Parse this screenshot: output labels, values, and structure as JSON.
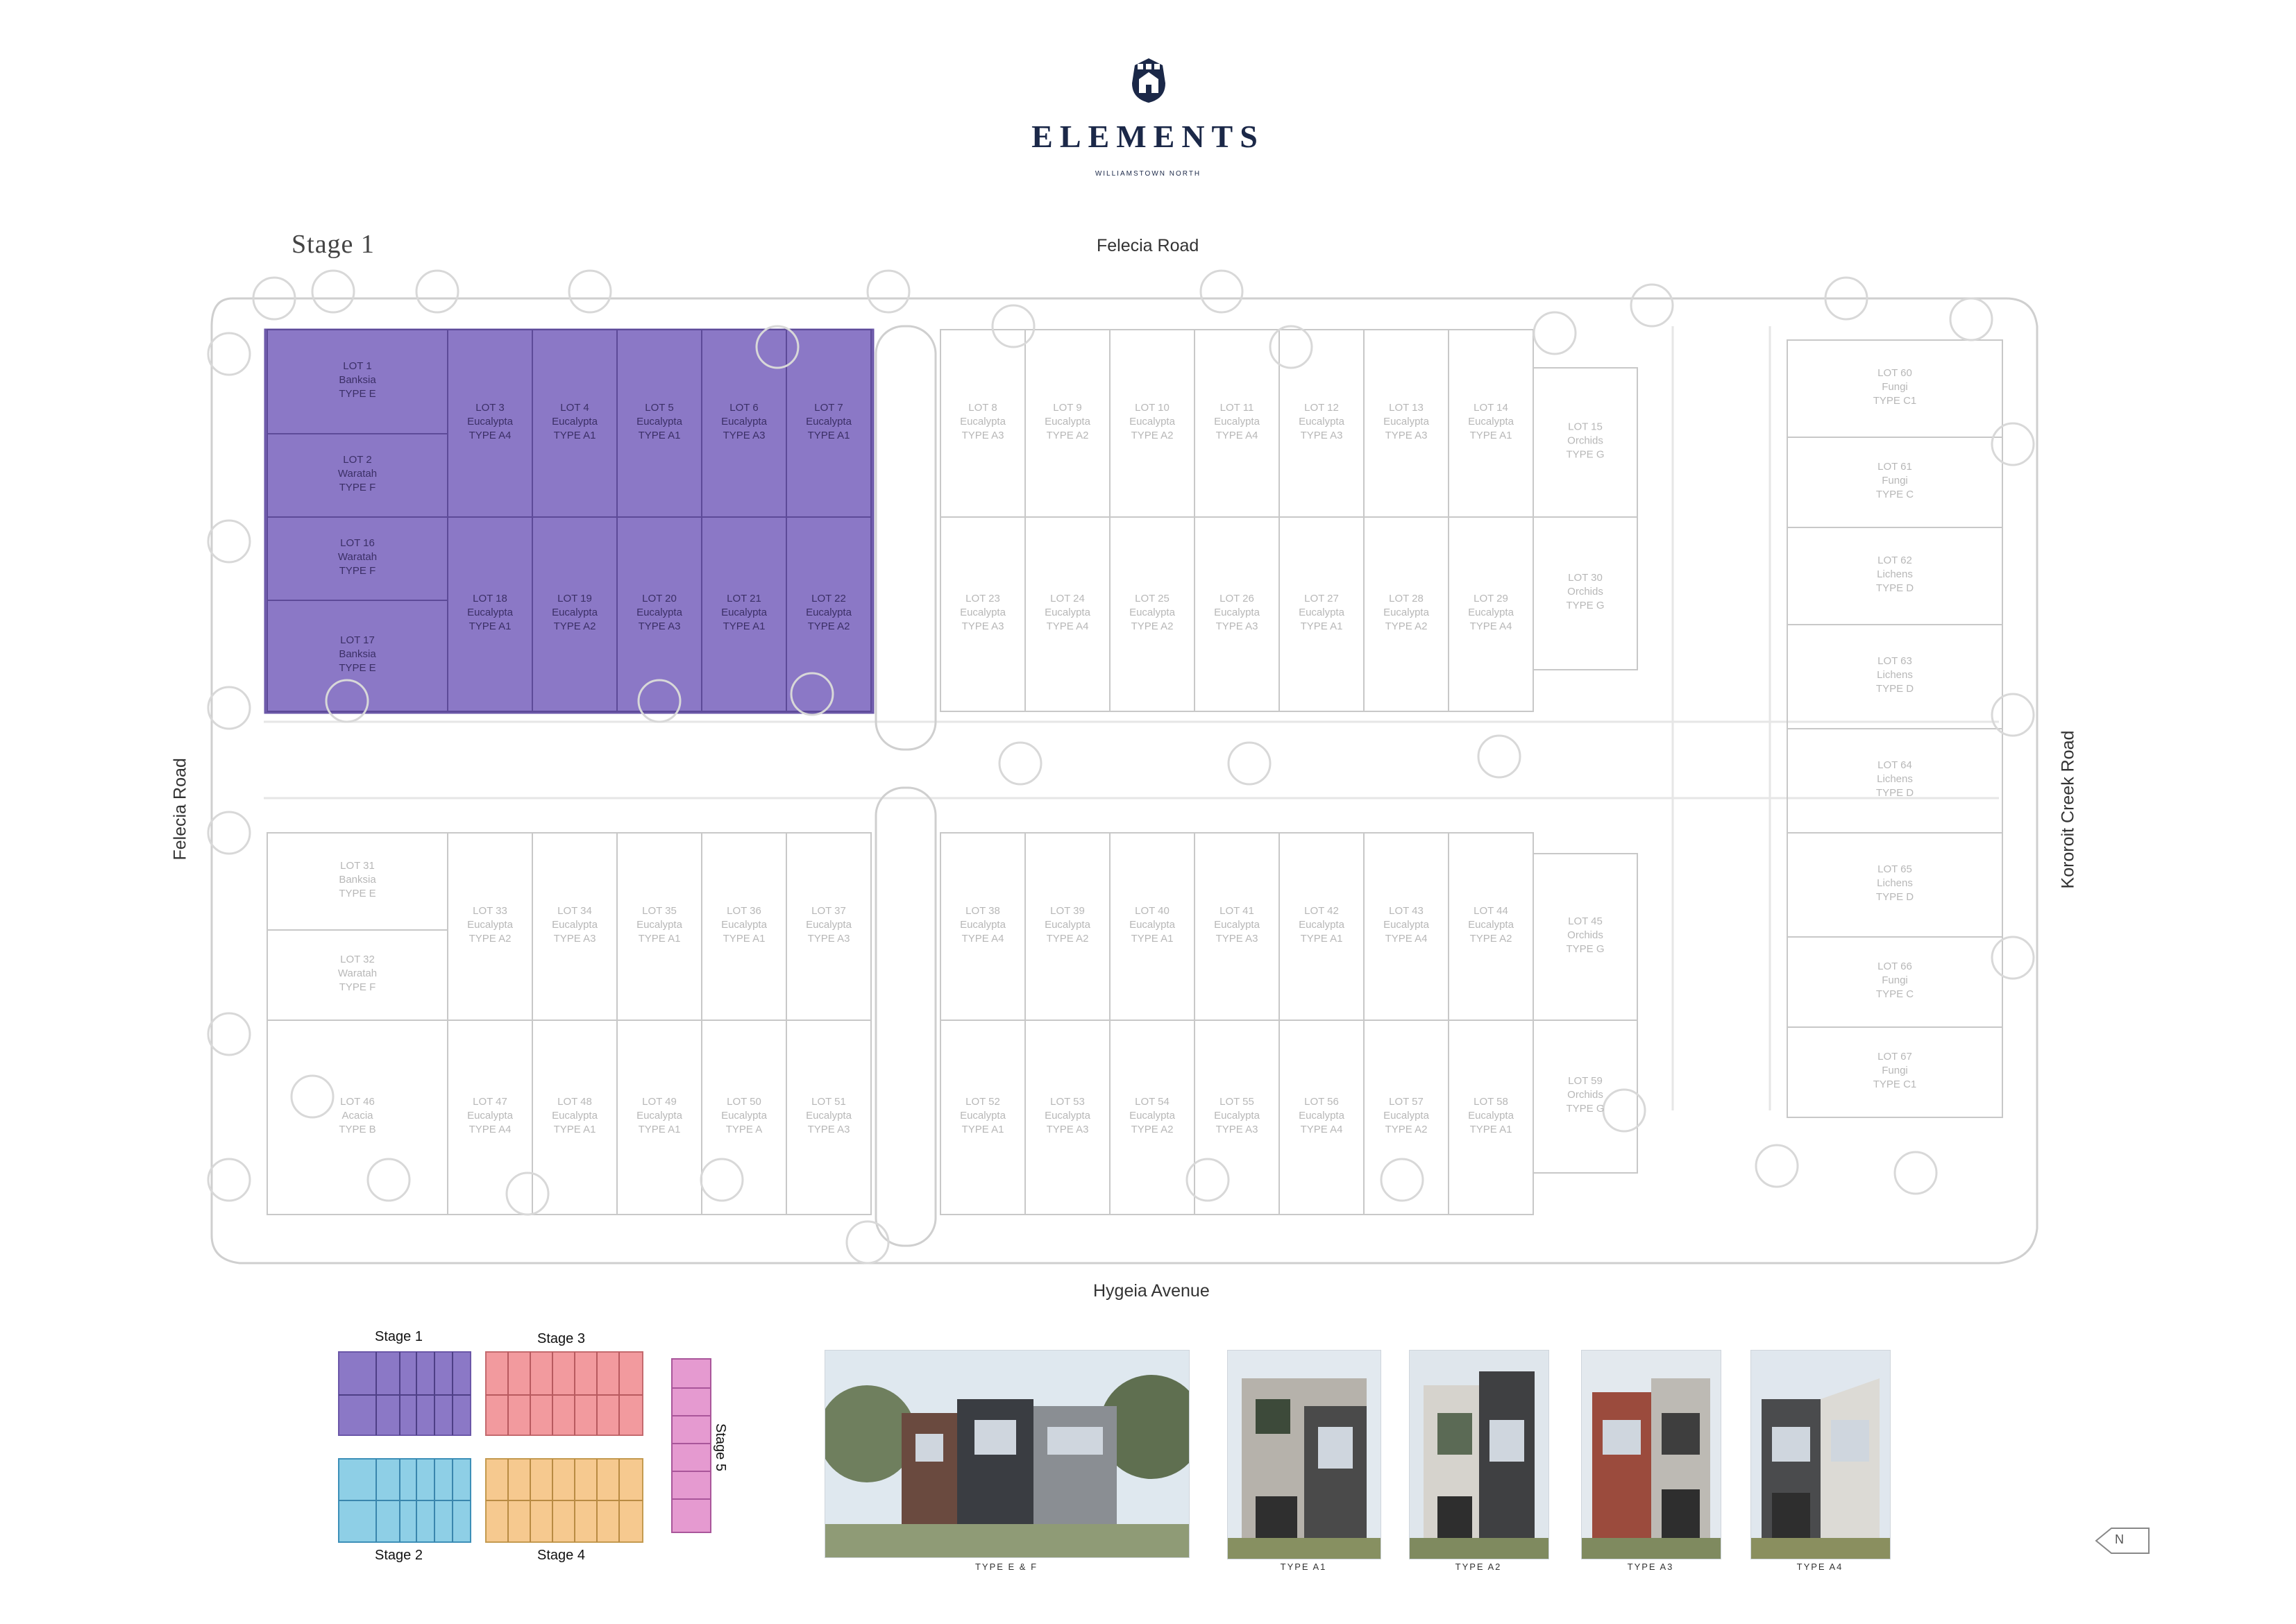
{
  "brand": {
    "name": "ELEMENTS",
    "subtitle": "WILLIAMSTOWN NORTH",
    "logo_icon": "house-crest-logo"
  },
  "stage_title": "Stage 1",
  "roads": {
    "north": "Felecia Road",
    "west": "Felecia Road",
    "south": "Hygeia Avenue",
    "east": "Kororoit Creek Road"
  },
  "colors": {
    "stage1": "#8b78c6",
    "stage1_border": "#6b57a8",
    "stage2": "#8ecfe6",
    "stage3": "#f29a9e",
    "stage4": "#f6c98f",
    "stage5": "#e59ad0",
    "linework": "#c8c8c8",
    "label_grey": "#b7b7b7",
    "brand_navy": "#1b2848"
  },
  "lots": [
    {
      "id": "LOT 1",
      "name": "Banksia",
      "type": "TYPE E",
      "stage": 1
    },
    {
      "id": "LOT 2",
      "name": "Waratah",
      "type": "TYPE F",
      "stage": 1
    },
    {
      "id": "LOT 3",
      "name": "Eucalypta",
      "type": "TYPE A4",
      "stage": 1
    },
    {
      "id": "LOT 4",
      "name": "Eucalypta",
      "type": "TYPE A1",
      "stage": 1
    },
    {
      "id": "LOT 5",
      "name": "Eucalypta",
      "type": "TYPE A1",
      "stage": 1
    },
    {
      "id": "LOT 6",
      "name": "Eucalypta",
      "type": "TYPE A3",
      "stage": 1
    },
    {
      "id": "LOT 7",
      "name": "Eucalypta",
      "type": "TYPE A1",
      "stage": 1
    },
    {
      "id": "LOT 16",
      "name": "Waratah",
      "type": "TYPE F",
      "stage": 1
    },
    {
      "id": "LOT 17",
      "name": "Banksia",
      "type": "TYPE E",
      "stage": 1
    },
    {
      "id": "LOT 18",
      "name": "Eucalypta",
      "type": "TYPE A1",
      "stage": 1
    },
    {
      "id": "LOT 19",
      "name": "Eucalypta",
      "type": "TYPE A2",
      "stage": 1
    },
    {
      "id": "LOT 20",
      "name": "Eucalypta",
      "type": "TYPE A3",
      "stage": 1
    },
    {
      "id": "LOT 21",
      "name": "Eucalypta",
      "type": "TYPE A1",
      "stage": 1
    },
    {
      "id": "LOT 22",
      "name": "Eucalypta",
      "type": "TYPE A2",
      "stage": 1
    },
    {
      "id": "LOT 8",
      "name": "Eucalypta",
      "type": "TYPE A3",
      "stage": 0
    },
    {
      "id": "LOT 9",
      "name": "Eucalypta",
      "type": "TYPE A2",
      "stage": 0
    },
    {
      "id": "LOT 10",
      "name": "Eucalypta",
      "type": "TYPE A2",
      "stage": 0
    },
    {
      "id": "LOT 11",
      "name": "Eucalypta",
      "type": "TYPE A4",
      "stage": 0
    },
    {
      "id": "LOT 12",
      "name": "Eucalypta",
      "type": "TYPE A3",
      "stage": 0
    },
    {
      "id": "LOT 13",
      "name": "Eucalypta",
      "type": "TYPE A3",
      "stage": 0
    },
    {
      "id": "LOT 14",
      "name": "Eucalypta",
      "type": "TYPE A1",
      "stage": 0
    },
    {
      "id": "LOT 15",
      "name": "Orchids",
      "type": "TYPE G",
      "stage": 0
    },
    {
      "id": "LOT 23",
      "name": "Eucalypta",
      "type": "TYPE A3",
      "stage": 0
    },
    {
      "id": "LOT 24",
      "name": "Eucalypta",
      "type": "TYPE A4",
      "stage": 0
    },
    {
      "id": "LOT 25",
      "name": "Eucalypta",
      "type": "TYPE A2",
      "stage": 0
    },
    {
      "id": "LOT 26",
      "name": "Eucalypta",
      "type": "TYPE A3",
      "stage": 0
    },
    {
      "id": "LOT 27",
      "name": "Eucalypta",
      "type": "TYPE A1",
      "stage": 0
    },
    {
      "id": "LOT 28",
      "name": "Eucalypta",
      "type": "TYPE A2",
      "stage": 0
    },
    {
      "id": "LOT 29",
      "name": "Eucalypta",
      "type": "TYPE A4",
      "stage": 0
    },
    {
      "id": "LOT 30",
      "name": "Orchids",
      "type": "TYPE G",
      "stage": 0
    },
    {
      "id": "LOT 31",
      "name": "Banksia",
      "type": "TYPE E",
      "stage": 0
    },
    {
      "id": "LOT 32",
      "name": "Waratah",
      "type": "TYPE F",
      "stage": 0
    },
    {
      "id": "LOT 33",
      "name": "Eucalypta",
      "type": "TYPE A2",
      "stage": 0
    },
    {
      "id": "LOT 34",
      "name": "Eucalypta",
      "type": "TYPE A3",
      "stage": 0
    },
    {
      "id": "LOT 35",
      "name": "Eucalypta",
      "type": "TYPE A1",
      "stage": 0
    },
    {
      "id": "LOT 36",
      "name": "Eucalypta",
      "type": "TYPE A1",
      "stage": 0
    },
    {
      "id": "LOT 37",
      "name": "Eucalypta",
      "type": "TYPE A3",
      "stage": 0
    },
    {
      "id": "LOT 38",
      "name": "Eucalypta",
      "type": "TYPE A4",
      "stage": 0
    },
    {
      "id": "LOT 39",
      "name": "Eucalypta",
      "type": "TYPE A2",
      "stage": 0
    },
    {
      "id": "LOT 40",
      "name": "Eucalypta",
      "type": "TYPE A1",
      "stage": 0
    },
    {
      "id": "LOT 41",
      "name": "Eucalypta",
      "type": "TYPE A3",
      "stage": 0
    },
    {
      "id": "LOT 42",
      "name": "Eucalypta",
      "type": "TYPE A1",
      "stage": 0
    },
    {
      "id": "LOT 43",
      "name": "Eucalypta",
      "type": "TYPE A4",
      "stage": 0
    },
    {
      "id": "LOT 44",
      "name": "Eucalypta",
      "type": "TYPE A2",
      "stage": 0
    },
    {
      "id": "LOT 45",
      "name": "Orchids",
      "type": "TYPE G",
      "stage": 0
    },
    {
      "id": "LOT 46",
      "name": "Acacia",
      "type": "TYPE B",
      "stage": 0
    },
    {
      "id": "LOT 47",
      "name": "Eucalypta",
      "type": "TYPE A4",
      "stage": 0
    },
    {
      "id": "LOT 48",
      "name": "Eucalypta",
      "type": "TYPE A1",
      "stage": 0
    },
    {
      "id": "LOT 49",
      "name": "Eucalypta",
      "type": "TYPE A1",
      "stage": 0
    },
    {
      "id": "LOT 50",
      "name": "Eucalypta",
      "type": "TYPE A",
      "stage": 0
    },
    {
      "id": "LOT 51",
      "name": "Eucalypta",
      "type": "TYPE A3",
      "stage": 0
    },
    {
      "id": "LOT 52",
      "name": "Eucalypta",
      "type": "TYPE A1",
      "stage": 0
    },
    {
      "id": "LOT 53",
      "name": "Eucalypta",
      "type": "TYPE A3",
      "stage": 0
    },
    {
      "id": "LOT 54",
      "name": "Eucalypta",
      "type": "TYPE A2",
      "stage": 0
    },
    {
      "id": "LOT 55",
      "name": "Eucalypta",
      "type": "TYPE A3",
      "stage": 0
    },
    {
      "id": "LOT 56",
      "name": "Eucalypta",
      "type": "TYPE A4",
      "stage": 0
    },
    {
      "id": "LOT 57",
      "name": "Eucalypta",
      "type": "TYPE A2",
      "stage": 0
    },
    {
      "id": "LOT 58",
      "name": "Eucalypta",
      "type": "TYPE A1",
      "stage": 0
    },
    {
      "id": "LOT 59",
      "name": "Orchids",
      "type": "TYPE G",
      "stage": 0
    },
    {
      "id": "LOT 60",
      "name": "Fungi",
      "type": "TYPE C1",
      "stage": 0
    },
    {
      "id": "LOT 61",
      "name": "Fungi",
      "type": "TYPE C",
      "stage": 0
    },
    {
      "id": "LOT 62",
      "name": "Lichens",
      "type": "TYPE D",
      "stage": 0
    },
    {
      "id": "LOT 63",
      "name": "Lichens",
      "type": "TYPE D",
      "stage": 0
    },
    {
      "id": "LOT 64",
      "name": "Lichens",
      "type": "TYPE D",
      "stage": 0
    },
    {
      "id": "LOT 65",
      "name": "Lichens",
      "type": "TYPE D",
      "stage": 0
    },
    {
      "id": "LOT 66",
      "name": "Fungi",
      "type": "TYPE C",
      "stage": 0
    },
    {
      "id": "LOT 67",
      "name": "Fungi",
      "type": "TYPE C1",
      "stage": 0
    }
  ],
  "stage_key": [
    {
      "label": "Stage 1",
      "color": "#8b78c6"
    },
    {
      "label": "Stage 2",
      "color": "#8ecfe6"
    },
    {
      "label": "Stage 3",
      "color": "#f29a9e"
    },
    {
      "label": "Stage 4",
      "color": "#f6c98f"
    },
    {
      "label": "Stage 5",
      "color": "#e59ad0"
    }
  ],
  "photos": [
    {
      "caption": "TYPE E & F"
    },
    {
      "caption": "TYPE A1"
    },
    {
      "caption": "TYPE A2"
    },
    {
      "caption": "TYPE A3"
    },
    {
      "caption": "TYPE A4"
    }
  ],
  "compass": {
    "letter": "N",
    "icon": "north-arrow-icon"
  }
}
